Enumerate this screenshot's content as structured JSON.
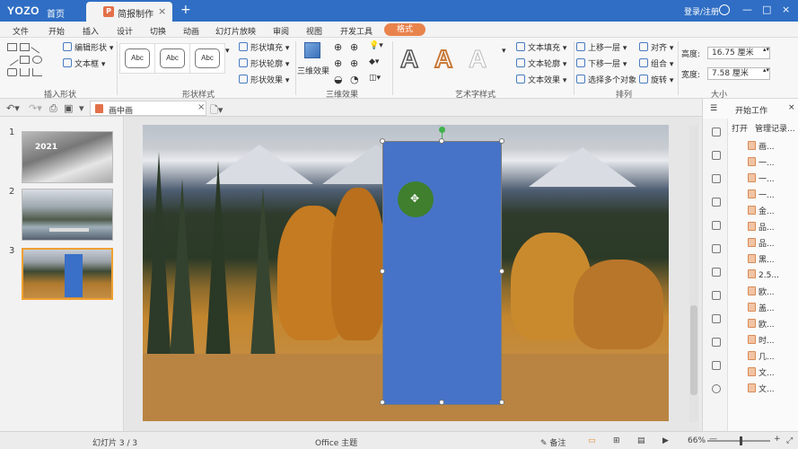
{
  "title_bar": {
    "logo": "YOZO",
    "home": "首页",
    "doc_tab_title": "简报制作",
    "doc_tab_close": "×",
    "add_tab": "+",
    "login": "登录/注册",
    "minimize": "—",
    "maximize": "□",
    "close": "×"
  },
  "menu": [
    "文件",
    "开始",
    "插入",
    "设计",
    "切换",
    "动画",
    "幻灯片放映",
    "审阅",
    "视图",
    "开发工具"
  ],
  "menu_active": "格式",
  "ribbon": {
    "insert_shape": {
      "edit_shape": "编辑形状",
      "text_box": "文本框",
      "label": "插入形状"
    },
    "shape_styles": {
      "abc": [
        "Abc",
        "Abc",
        "Abc"
      ],
      "fill": "形状填充",
      "outline": "形状轮廓",
      "effect": "形状效果",
      "label": "形状样式"
    },
    "three_d": {
      "button": "三维效果",
      "label": "三维效果"
    },
    "wordart": {
      "letters": [
        "A",
        "A",
        "A"
      ],
      "text_fill": "文本填充",
      "text_outline": "文本轮廓",
      "text_effect": "文本效果",
      "label": "艺术字样式"
    },
    "arrange": {
      "bring_forward": "上移一层",
      "send_backward": "下移一层",
      "select_multiple": "选择多个对象",
      "align": "对齐",
      "group": "组合",
      "rotate": "旋转",
      "label": "排列"
    },
    "size": {
      "height_label": "高度:",
      "height_value": "16.75 厘米",
      "width_label": "宽度:",
      "width_value": "7.58 厘米",
      "label": "大小"
    }
  },
  "quickbar": {
    "file_name": "画中画",
    "close": "×"
  },
  "thumbnails": [
    {
      "num": "1",
      "text": "2021"
    },
    {
      "num": "2"
    },
    {
      "num": "3"
    }
  ],
  "right_panel": {
    "title": "开始工作",
    "open": "打开",
    "manage": "管理记录...",
    "items": [
      "画...",
      "一...",
      "一...",
      "一...",
      "金...",
      "品...",
      "品...",
      "黑...",
      "2.5...",
      "欧...",
      "盖...",
      "欧...",
      "时...",
      "几...",
      "文...",
      "文..."
    ]
  },
  "status_bar": {
    "slide_info": "幻灯片 3 / 3",
    "theme": "Office 主题",
    "notes": "备注",
    "zoom": "66%",
    "zoom_minus": "—",
    "zoom_plus": "+"
  },
  "colors": {
    "title_bar": "#2f6ec4",
    "accent_tab": "#e9834c",
    "shape_fill": "#4673c8",
    "thumb_selected": "#f0a030"
  }
}
